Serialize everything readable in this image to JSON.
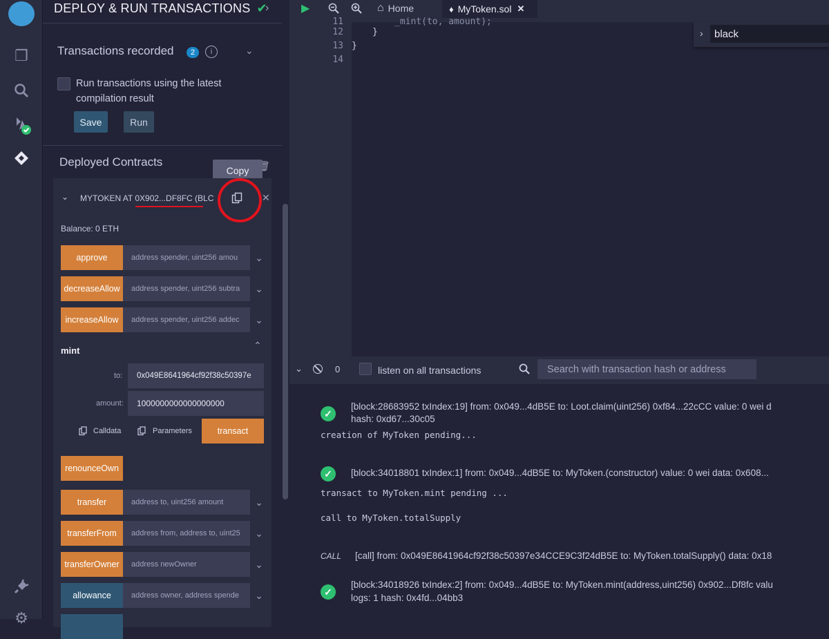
{
  "panel": {
    "title": "DEPLOY & RUN TRANSACTIONS",
    "tx_recorded": {
      "label": "Transactions recorded",
      "count": "2"
    },
    "run_latest": "Run transactions using the latest compilation result",
    "run_latest_line1": "Run transactions using the latest",
    "run_latest_line2": "compilation result",
    "save": "Save",
    "run": "Run",
    "deployed": "Deployed Contracts",
    "tooltip": "Copy",
    "contract": "MYTOKEN AT 0X902...DF8FC (BLC",
    "balance": "Balance: 0 ETH",
    "functions": [
      {
        "label": "approve",
        "placeholder": "address spender, uint256 amou",
        "color": "orange"
      },
      {
        "label": "decreaseAllow",
        "placeholder": "address spender, uint256 subtra",
        "color": "orange"
      },
      {
        "label": "increaseAllow",
        "placeholder": "address spender, uint256 addec",
        "color": "orange"
      }
    ],
    "mint": {
      "title": "mint",
      "to_label": "to:",
      "to_value": "0x049E8641964cf92f38c50397e",
      "amount_label": "amount:",
      "amount_value": "1000000000000000000",
      "calldata": "Calldata",
      "parameters": "Parameters",
      "transact": "transact"
    },
    "functions2": [
      {
        "label": "renounceOwn",
        "placeholder": "",
        "color": "orange"
      },
      {
        "label": "transfer",
        "placeholder": "address to, uint256 amount",
        "color": "orange"
      },
      {
        "label": "transferFrom",
        "placeholder": "address from, address to, uint25",
        "color": "orange"
      },
      {
        "label": "transferOwner",
        "placeholder": "address newOwner",
        "color": "orange"
      },
      {
        "label": "allowance",
        "placeholder": "address owner, address spende",
        "color": "blue"
      }
    ]
  },
  "topbar": {
    "home": "Home",
    "file_tab": "MyToken.sol"
  },
  "editor": {
    "lines": [
      "12",
      "13",
      "14"
    ],
    "code": [
      "        }",
      "    }",
      ""
    ],
    "find_value": "black"
  },
  "terminal": {
    "pending_count": "0",
    "listen": "listen on all transactions",
    "search_placeholder": "Search with transaction hash or address",
    "entries": {
      "e1_head": "[block:28683952 txIndex:19]   from: 0x049...4dB5E to: Loot.claim(uint256) 0xf84...22cCC value: 0 wei d",
      "e1_hash": "hash: 0xd67...30c05",
      "creation": "creation of MyToken pending...",
      "e2_head": "[block:34018801 txIndex:1]   from: 0x049...4dB5E to: MyToken.(constructor) value: 0 wei data: 0x608...",
      "transact": "transact to MyToken.mint pending ...",
      "call": "call to MyToken.totalSupply",
      "call_tag": "CALL",
      "call_head": "[call]   from: 0x049E8641964cf92f38c50397e34CCE9C3f24dB5E to: MyToken.totalSupply() data: 0x18",
      "e3_head": "[block:34018926 txIndex:2]   from: 0x049...4dB5E to: MyToken.mint(address,uint256) 0x902...Df8fc valu",
      "e3_hash": "logs: 1  hash: 0x4fd...04bb3"
    }
  },
  "colors": {
    "bg": "#222336",
    "panel": "#2a2c3f",
    "orange": "#d4803a",
    "blue": "#2f5774",
    "green": "#2fbf71",
    "red": "#e0141e"
  }
}
